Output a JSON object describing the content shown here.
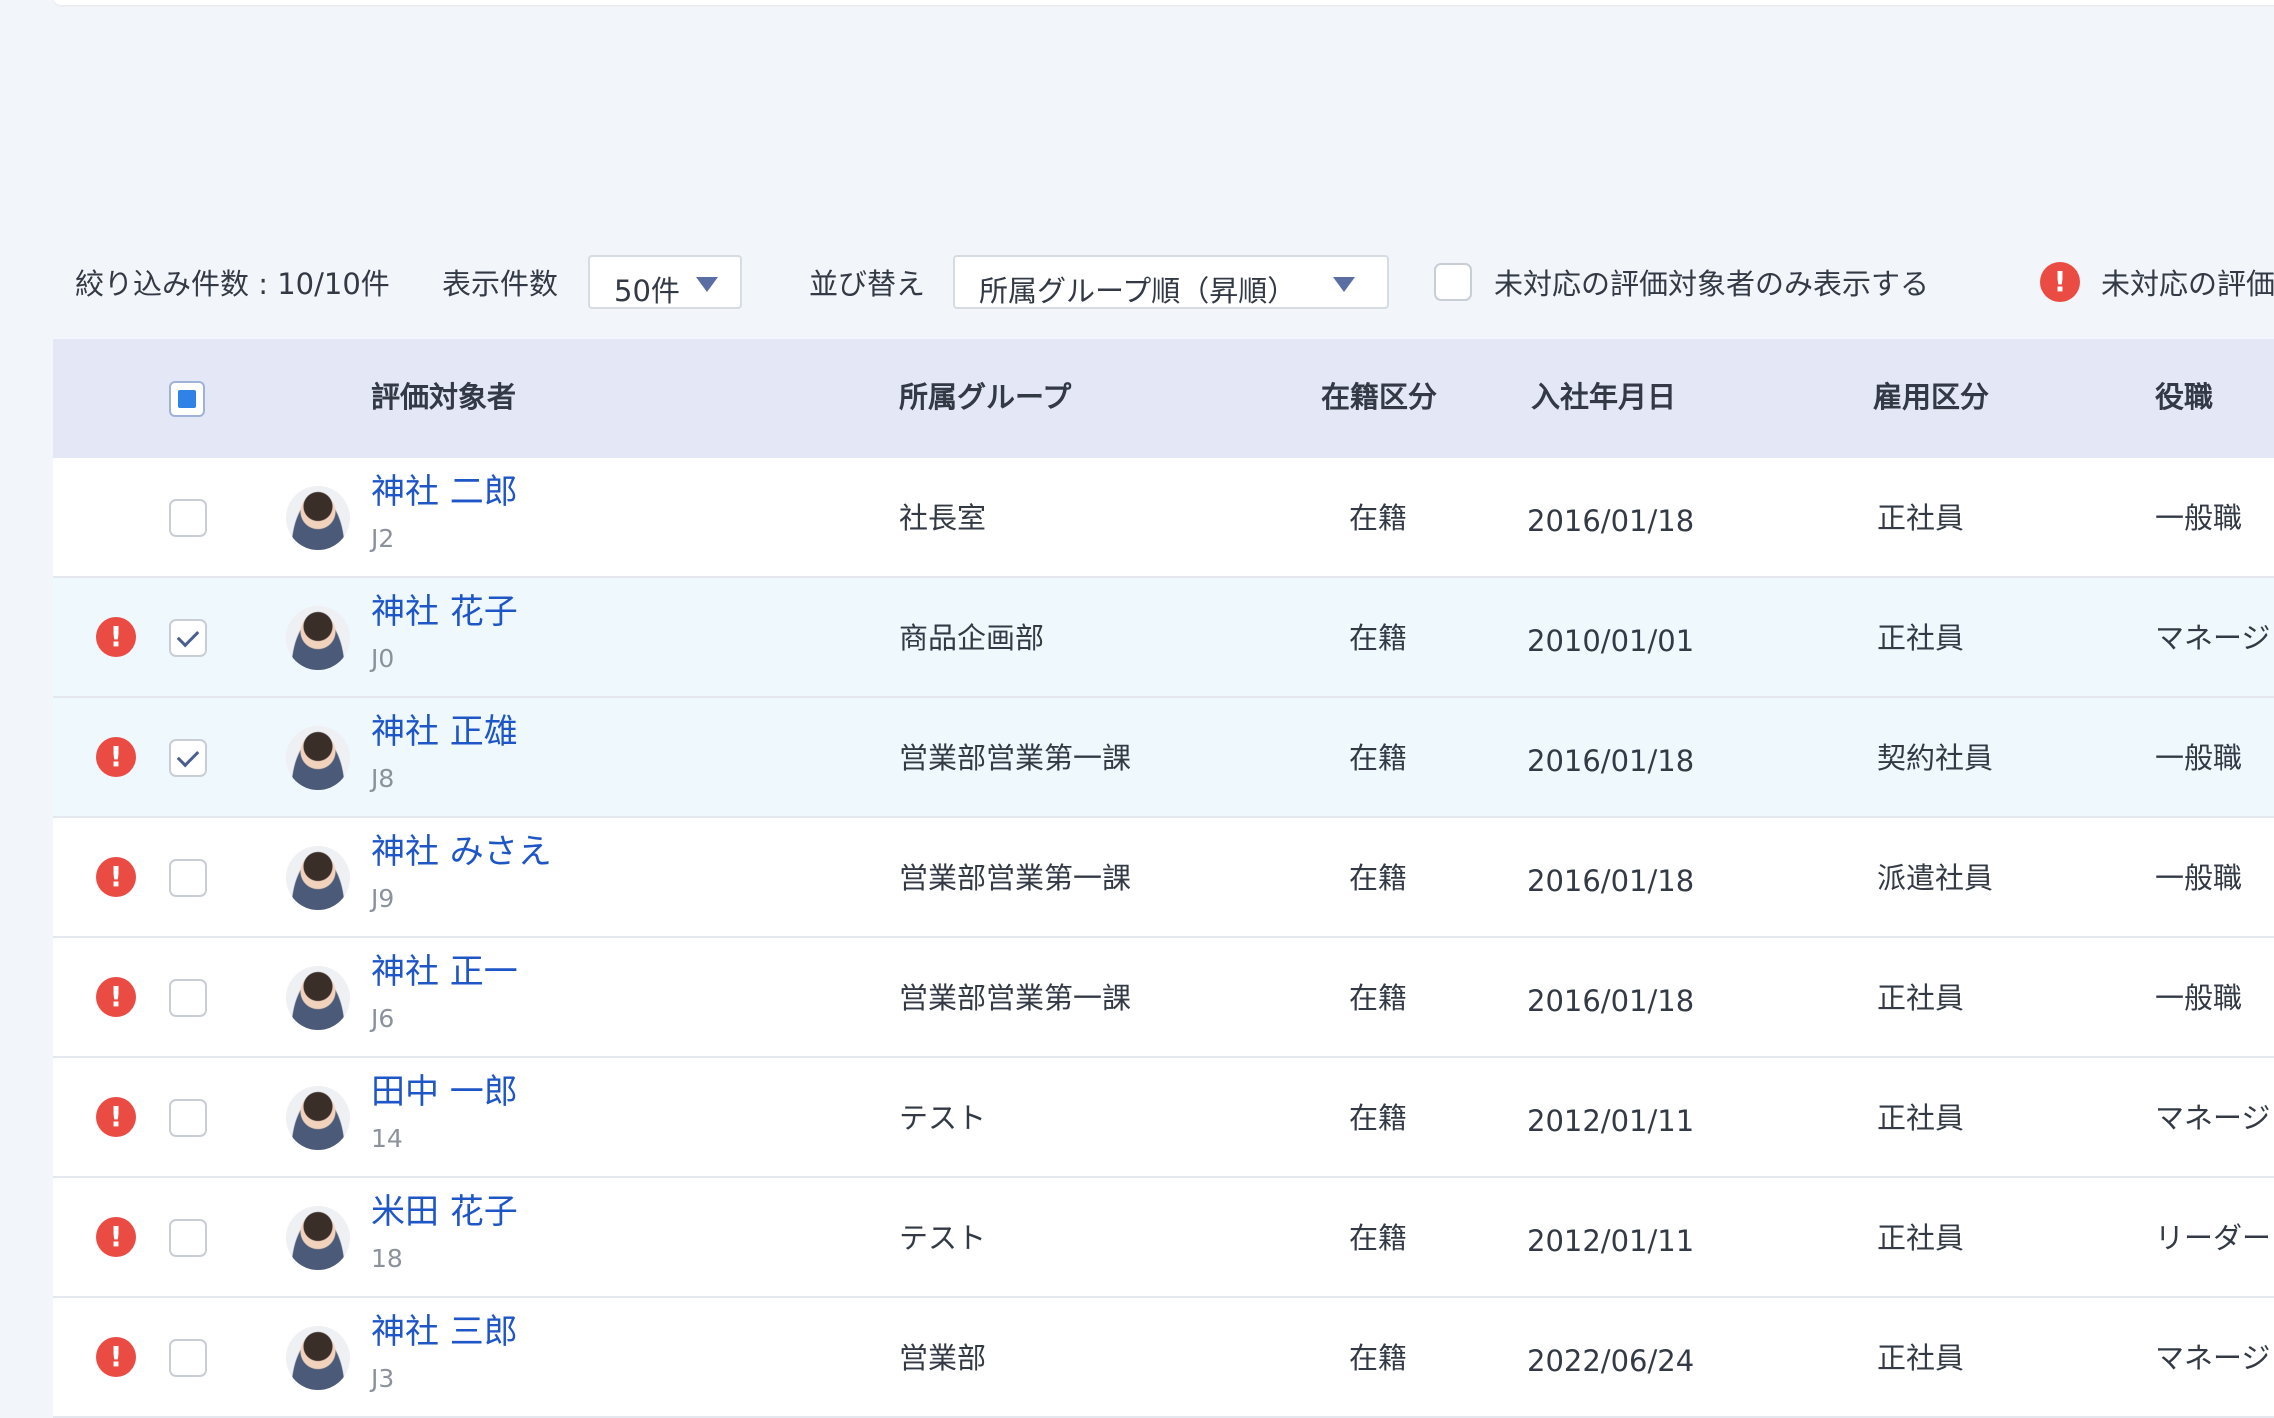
{
  "toolbar": {
    "filter_count": "絞り込み件数 : 10/10件",
    "display_count_label": "表示件数",
    "display_count_value": "50件",
    "sort_label": "並び替え",
    "sort_value": "所属グループ順（昇順）",
    "unresponded_only_label": "未対応の評価対象者のみ表示する",
    "legend_text": "未対応の評価"
  },
  "table": {
    "columns": [
      "評価対象者",
      "所属グループ",
      "在籍区分",
      "入社年月日",
      "雇用区分",
      "役職"
    ],
    "rows": [
      {
        "alert": false,
        "checked": false,
        "name": "神社 二郎",
        "code": "J2",
        "group": "社長室",
        "status": "在籍",
        "join_date": "2016/01/18",
        "employment": "正社員",
        "position": "一般職"
      },
      {
        "alert": true,
        "checked": true,
        "name": "神社 花子",
        "code": "J0",
        "group": "商品企画部",
        "status": "在籍",
        "join_date": "2010/01/01",
        "employment": "正社員",
        "position": "マネージ"
      },
      {
        "alert": true,
        "checked": true,
        "name": "神社 正雄",
        "code": "J8",
        "group": "営業部営業第一課",
        "status": "在籍",
        "join_date": "2016/01/18",
        "employment": "契約社員",
        "position": "一般職"
      },
      {
        "alert": true,
        "checked": false,
        "name": "神社 みさえ",
        "code": "J9",
        "group": "営業部営業第一課",
        "status": "在籍",
        "join_date": "2016/01/18",
        "employment": "派遣社員",
        "position": "一般職"
      },
      {
        "alert": true,
        "checked": false,
        "name": "神社 正一",
        "code": "J6",
        "group": "営業部営業第一課",
        "status": "在籍",
        "join_date": "2016/01/18",
        "employment": "正社員",
        "position": "一般職"
      },
      {
        "alert": true,
        "checked": false,
        "name": "田中 一郎",
        "code": "14",
        "group": "テスト",
        "status": "在籍",
        "join_date": "2012/01/11",
        "employment": "正社員",
        "position": "マネージ"
      },
      {
        "alert": true,
        "checked": false,
        "name": "米田 花子",
        "code": "18",
        "group": "テスト",
        "status": "在籍",
        "join_date": "2012/01/11",
        "employment": "正社員",
        "position": "リーダー"
      },
      {
        "alert": true,
        "checked": false,
        "name": "神社 三郎",
        "code": "J3",
        "group": "営業部",
        "status": "在籍",
        "join_date": "2022/06/24",
        "employment": "正社員",
        "position": "マネージ"
      }
    ]
  },
  "colors": {
    "link": "#1f56c7",
    "alert": "#ea4b43",
    "header_bg": "#e4e8f6",
    "selected_row_bg": "#eef8fd",
    "checkbox_accent": "#2f82e6"
  },
  "icons": {
    "alert": "exclamation-circle-icon",
    "caret": "caret-down-icon"
  }
}
